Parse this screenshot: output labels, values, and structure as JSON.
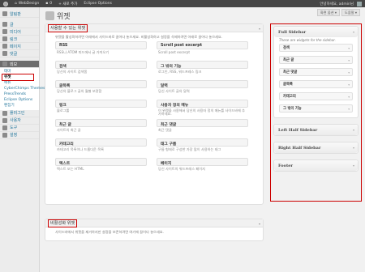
{
  "adminbar": {
    "site_name": "WebDesign",
    "comments_count": "0",
    "new_label": "+ 새로 추가",
    "eclipse_label": "Eclipse Options",
    "howdy": "안녕하세요, admin님"
  },
  "screen": {
    "options_label": "화면 옵션 ▾",
    "help_label": "도움말 ▾"
  },
  "sidemenu": {
    "items_top": [
      {
        "label": "알림판"
      },
      {
        "label": "글"
      },
      {
        "label": "미디어"
      },
      {
        "label": "링크"
      },
      {
        "label": "페이지"
      },
      {
        "label": "댓글"
      }
    ],
    "appearance_label": "외모",
    "submenu": [
      "테마",
      "위젯",
      "메뉴",
      "CyberChimps Themes",
      "PressTrends",
      "Eclipse Options",
      "편집기"
    ],
    "items_bottom": [
      {
        "label": "플러그인"
      },
      {
        "label": "사용자"
      },
      {
        "label": "도구"
      },
      {
        "label": "설정"
      }
    ]
  },
  "page": {
    "title": "위젯"
  },
  "available": {
    "title": "사용할 수 있는 위젯",
    "description": "위젯을 활성화하려면 아래에서 사이드바로 끌어다 놓으세요. 비활성화하고 설정을 삭제하려면 아래로 끌어다 놓으세요.",
    "widgets": [
      {
        "title": "RSS",
        "desc": "RSS나 ATOM 피드에서 글 가져오기"
      },
      {
        "title": "Scroll post excerpt",
        "desc": "Scroll post excerpt"
      },
      {
        "title": "검색",
        "desc": "당신의 사이트 검색폼"
      },
      {
        "title": "그 밖의 기능",
        "desc": "로그인, RSS, 워드프레스 링크"
      },
      {
        "title": "글목록",
        "desc": "당신의 블로그 글의 월별 보관함"
      },
      {
        "title": "달력",
        "desc": "당신 사이트 글의 달력"
      },
      {
        "title": "링크",
        "desc": "블로그롤"
      },
      {
        "title": "사용자 정의 메뉴",
        "desc": "이 위젯을 사용해서 당신의 사용자 정의 메뉴를 사이드바에 추가하세요."
      },
      {
        "title": "최근 글",
        "desc": "사이트의 최근 글"
      },
      {
        "title": "최근 댓글",
        "desc": "최근 댓글"
      },
      {
        "title": "카테고리",
        "desc": "카테고리 목록이나 드롭다운 목록"
      },
      {
        "title": "태그 구름",
        "desc": "구름 형태로 구성한 가장 많이 사용하는 태그"
      },
      {
        "title": "텍스트",
        "desc": "텍스트 또는 HTML"
      },
      {
        "title": "페이지",
        "desc": "당신 사이트의 워드프레스 페이지"
      }
    ]
  },
  "inactive": {
    "title": "비활성화 위젯",
    "description": "사이드바에서 위젯을 제거하지만 설정을 보존하려면 여기에 끌어다 놓으세요."
  },
  "sidebars": [
    {
      "title": "Full Sidebar",
      "description": "These are widgets for the sidebar.",
      "widgets": [
        "검색",
        "최근 글",
        "최근 댓글",
        "글목록",
        "카테고리",
        "그 밖의 기능"
      ]
    },
    {
      "title": "Left Half Sidebar"
    },
    {
      "title": "Right Half Sidebar"
    },
    {
      "title": "Footer"
    }
  ]
}
